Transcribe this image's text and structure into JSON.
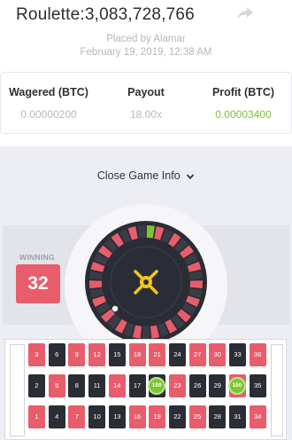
{
  "header": {
    "title": "Roulette:3,083,728,766",
    "placed_by": "Placed by Alamar",
    "date": "February 19, 2019, 12:38 AM",
    "share_icon": "share-arrow-icon"
  },
  "stats": {
    "wagered_label": "Wagered (BTC)",
    "wagered_value": "0.00000200",
    "payout_label": "Payout",
    "payout_value": "18.00x",
    "profit_label": "Profit (BTC)",
    "profit_value": "0.00003400",
    "profit_color": "#7cc13e"
  },
  "toggle": {
    "label": "Close Game Info",
    "icon": "chevron-down-icon"
  },
  "result": {
    "label": "WINNING",
    "number": "32",
    "color": "#e85d6c"
  },
  "board": {
    "rows": [
      [
        {
          "n": "3",
          "c": "red"
        },
        {
          "n": "6",
          "c": "black"
        },
        {
          "n": "9",
          "c": "red"
        },
        {
          "n": "12",
          "c": "red"
        },
        {
          "n": "15",
          "c": "black"
        },
        {
          "n": "18",
          "c": "red"
        },
        {
          "n": "21",
          "c": "red"
        },
        {
          "n": "24",
          "c": "black"
        },
        {
          "n": "27",
          "c": "red"
        },
        {
          "n": "30",
          "c": "red"
        },
        {
          "n": "33",
          "c": "black"
        },
        {
          "n": "36",
          "c": "red"
        }
      ],
      [
        {
          "n": "2",
          "c": "black"
        },
        {
          "n": "5",
          "c": "red"
        },
        {
          "n": "8",
          "c": "black"
        },
        {
          "n": "11",
          "c": "black"
        },
        {
          "n": "14",
          "c": "red"
        },
        {
          "n": "17",
          "c": "black"
        },
        {
          "n": "20",
          "c": "black"
        },
        {
          "n": "23",
          "c": "red"
        },
        {
          "n": "26",
          "c": "black"
        },
        {
          "n": "29",
          "c": "black"
        },
        {
          "n": "32",
          "c": "red"
        },
        {
          "n": "35",
          "c": "black"
        }
      ],
      [
        {
          "n": "1",
          "c": "red"
        },
        {
          "n": "4",
          "c": "black"
        },
        {
          "n": "7",
          "c": "red"
        },
        {
          "n": "10",
          "c": "black"
        },
        {
          "n": "13",
          "c": "black"
        },
        {
          "n": "16",
          "c": "red"
        },
        {
          "n": "19",
          "c": "red"
        },
        {
          "n": "22",
          "c": "black"
        },
        {
          "n": "25",
          "c": "red"
        },
        {
          "n": "28",
          "c": "black"
        },
        {
          "n": "31",
          "c": "black"
        },
        {
          "n": "34",
          "c": "red"
        }
      ]
    ],
    "chips": [
      {
        "row": 1,
        "col": 6,
        "label": "100"
      },
      {
        "row": 1,
        "col": 10,
        "label": "100"
      }
    ]
  },
  "colors": {
    "red": "#e85d6c",
    "black": "#2a2d35",
    "green": "#7ec437",
    "accent": "#f5c518"
  }
}
